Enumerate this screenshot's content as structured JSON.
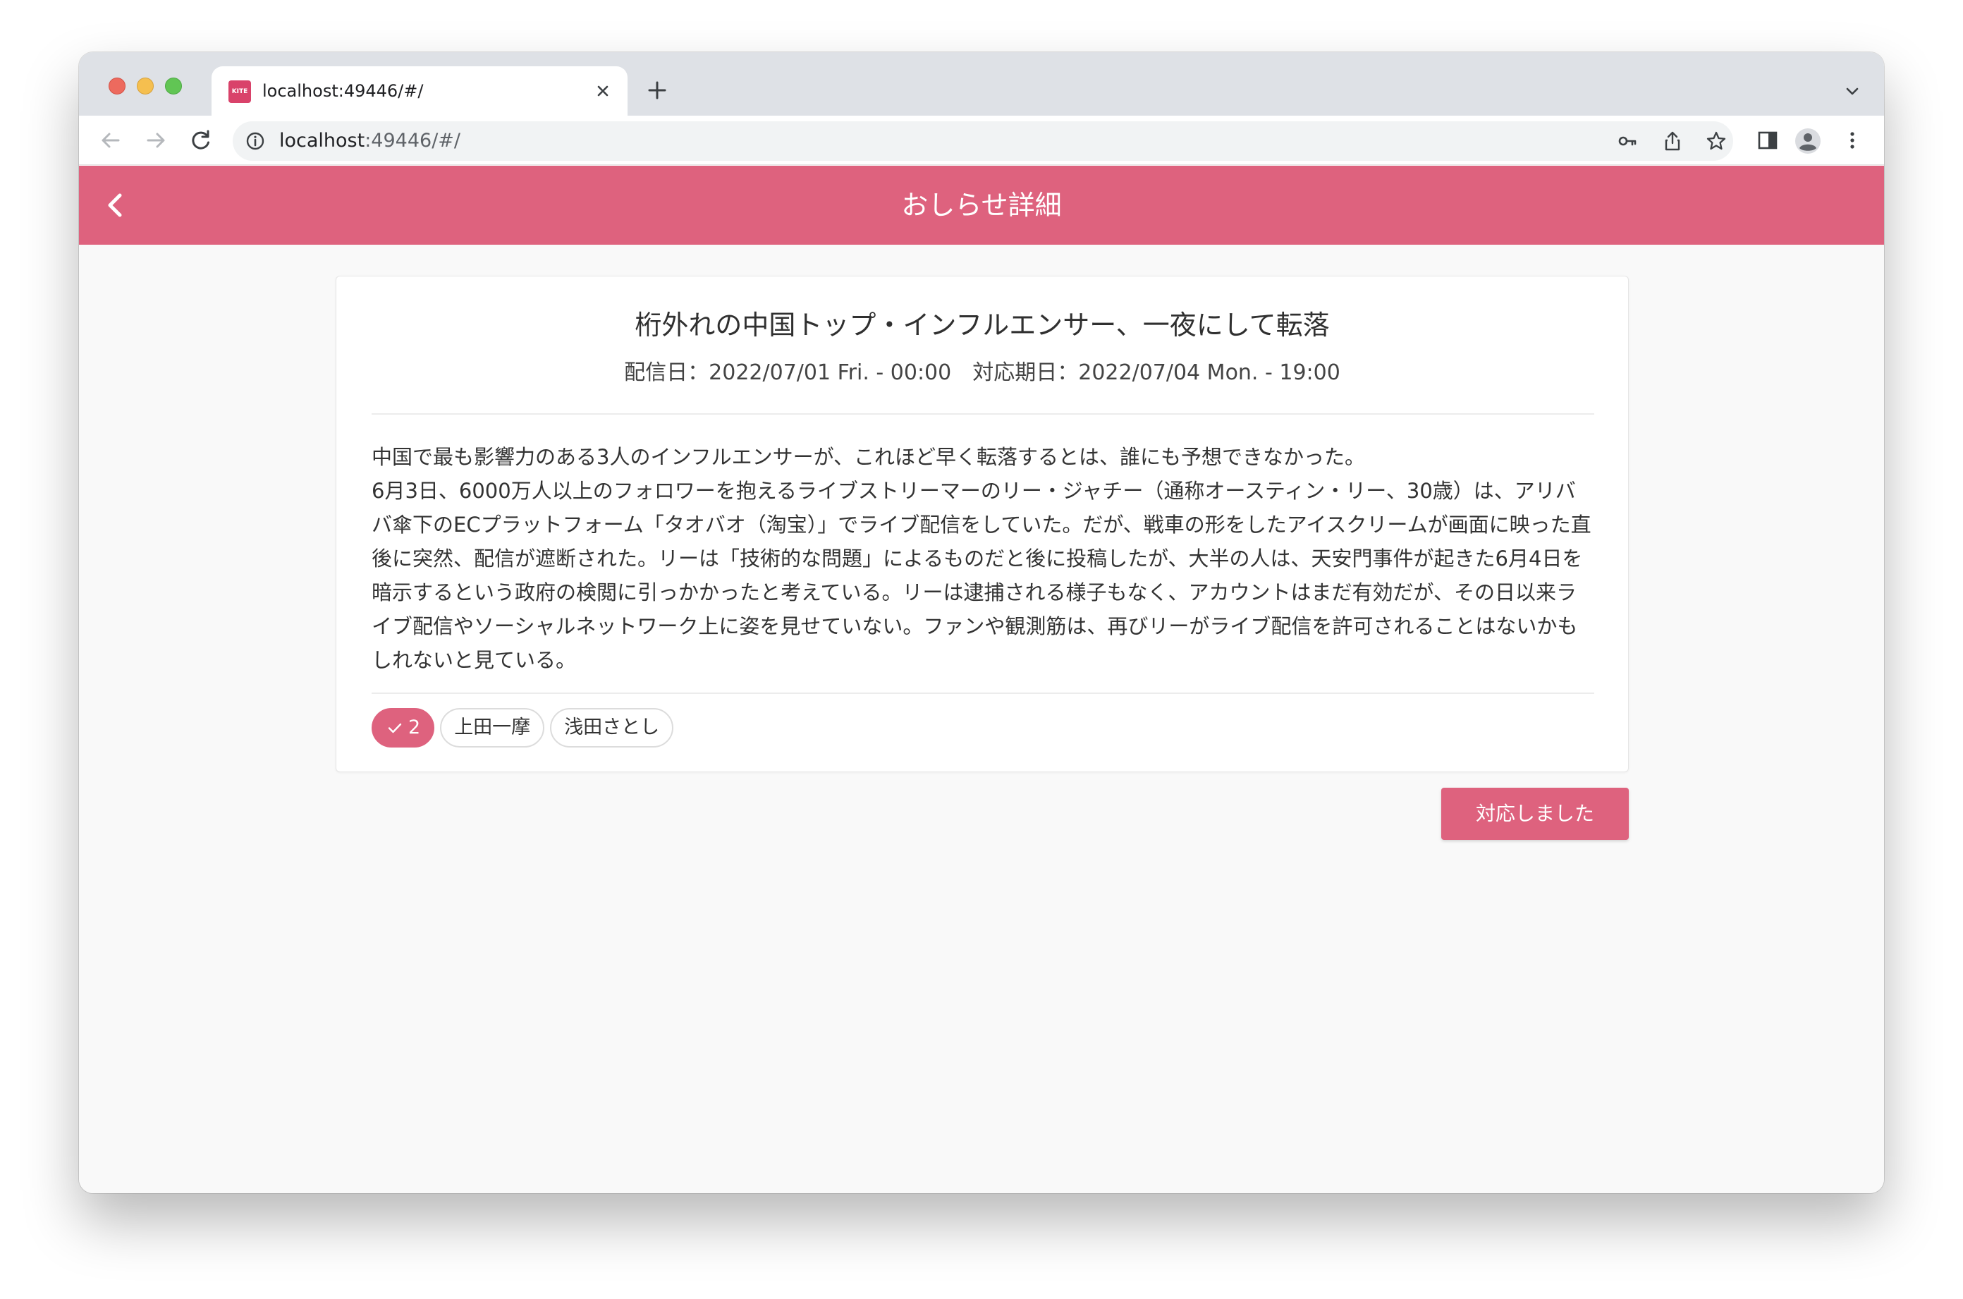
{
  "browser": {
    "tab": {
      "favicon_text": "KITE",
      "title": "localhost:49446/#/"
    },
    "address": {
      "host": "localhost",
      "rest": ":49446/#/"
    }
  },
  "app": {
    "header_title": "おしらせ詳細"
  },
  "notice": {
    "title": "桁外れの中国トップ・インフルエンサー、一夜にして転落",
    "meta": "配信日：2022/07/01 Fri. - 00:00　対応期日：2022/07/04 Mon. - 19:00",
    "body": [
      "中国で最も影響力のある3人のインフルエンサーが、これほど早く転落するとは、誰にも予想できなかった。",
      "6月3日、6000万人以上のフォロワーを抱えるライブストリーマーのリー・ジャチー（通称オースティン・リー、30歳）は、アリババ傘下のECプラットフォーム「タオバオ（淘宝）」でライブ配信をしていた。だが、戦車の形をしたアイスクリームが画面に映った直後に突然、配信が遮断された。リーは「技術的な問題」によるものだと後に投稿したが、大半の人は、天安門事件が起きた6月4日を暗示するという政府の検閲に引っかかったと考えている。リーは逮捕される様子もなく、アカウントはまだ有効だが、その日以来ライブ配信やソーシャルネットワーク上に姿を見せていない。ファンや観測筋は、再びリーがライブ配信を許可されることはないかもしれないと見ている。"
    ],
    "checked_count": "2",
    "users": [
      "上田一摩",
      "浅田さとし"
    ]
  },
  "actions": {
    "acknowledge_label": "対応しました"
  },
  "colors": {
    "accent": "#de627e",
    "tab_strip": "#dee1e6",
    "page_bg": "#f9f9f9"
  }
}
